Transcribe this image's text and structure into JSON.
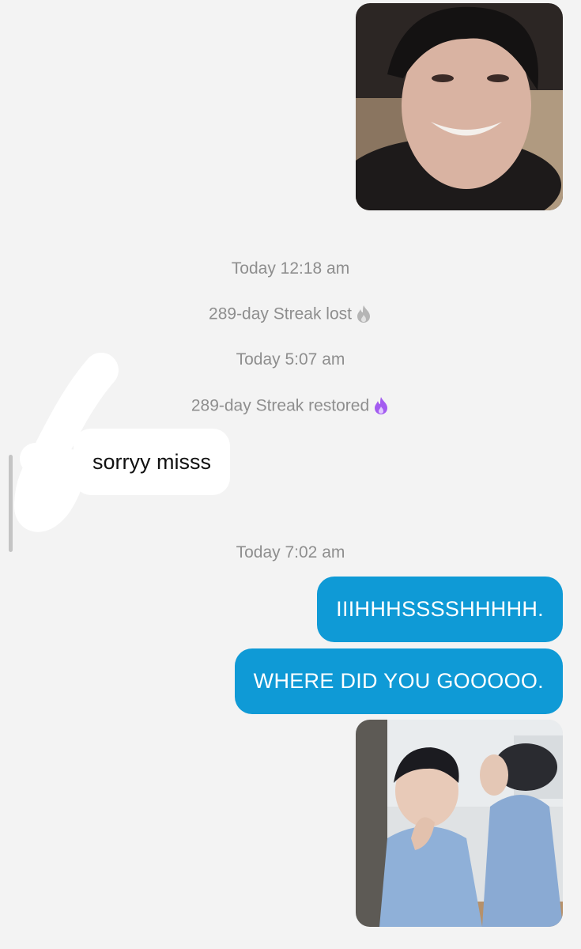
{
  "messages": {
    "system_1": "Today 12:18 am",
    "streak_lost": "289-day Streak lost",
    "system_2": "Today 5:07 am",
    "streak_restored": "289-day Streak restored",
    "incoming_1": "sorryy misss",
    "system_3": "Today 7:02 am",
    "outgoing_1": "IIIHHHSSSSHHHHH.",
    "outgoing_2": "WHERE DID YOU GOOOOO."
  },
  "icons": {
    "streak_lost_icon": "fire-icon-grey",
    "streak_restored_icon": "fire-icon-purple"
  },
  "colors": {
    "background": "#f3f3f3",
    "outgoing_bubble": "#0f9ad6",
    "incoming_bubble": "#ffffff",
    "system_text": "#8e8e8e",
    "flame_lost": "#b5b5b5",
    "flame_restored": "#a35cf0"
  }
}
